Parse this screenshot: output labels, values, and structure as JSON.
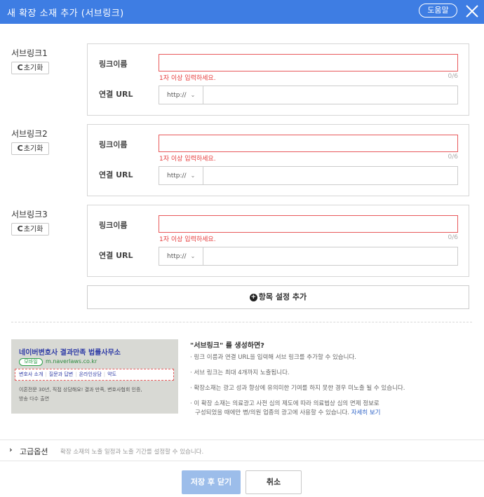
{
  "header": {
    "title": "새 확장 소재 추가 (서브링크)",
    "help_label": "도움말"
  },
  "reset_label": "초기화",
  "reset_icon_glyph": "C",
  "sublinks": [
    {
      "label": "서브링크1",
      "name_label": "링크이름",
      "error": "1자 이상 입력하세요.",
      "count": "0/6",
      "url_label": "연결 URL",
      "protocol": "http://"
    },
    {
      "label": "서브링크2",
      "name_label": "링크이름",
      "error": "1자 이상 입력하세요.",
      "count": "0/6",
      "url_label": "연결 URL",
      "protocol": "http://"
    },
    {
      "label": "서브링크3",
      "name_label": "링크이름",
      "error": "1자 이상 입력하세요.",
      "count": "0/6",
      "url_label": "연결 URL",
      "protocol": "http://"
    }
  ],
  "add_item_label": "항목 설정 추가",
  "preview": {
    "title": "네이버변호사 결과만족 법률사무소",
    "mobile_badge": "모바일",
    "url": "m.naverlaws.co.kr",
    "links": [
      "변호사 소개",
      "질문과 답변",
      "온라인상담",
      "약도"
    ],
    "desc_line1": "이혼전문 30년, 직접 상담해요! 결과 만족, 변호사협회 인증,",
    "desc_line2": "방송 다수 출연"
  },
  "info": {
    "title": "\"서브링크\" 를 생성하면?",
    "bullet1": "· 링크 이름과 연결 URL을 입력해 서브 링크를 추가할 수 있습니다.",
    "bullet2": "· 서브 링크는 최대 4개까지 노출됩니다.",
    "bullet3": "· 확장소재는 광고 성과 향상에 유의미한 기여를 하지 못한 경우 미노출 될 수 있습니다.",
    "bullet4_line1": "· 이 확장 소재는 의료광고 사전 심의 제도에 따라 의료법상 심의 면제 정보로",
    "bullet4_line2": "구성되었을 때에만 병/의원 업종의 광고에 사용할 수 있습니다.",
    "more_link": "자세히 보기"
  },
  "advanced": {
    "label": "고급옵션",
    "description": "확장 소재의 노출 일정과 노출 기간를 설정할 수 있습니다."
  },
  "footer": {
    "save_label": "저장 후 닫기",
    "cancel_label": "취소"
  },
  "colors": {
    "header_bg": "#3e7de3",
    "error": "#e63c3c",
    "save_button_bg": "#9cbdea",
    "link": "#2e63c7"
  }
}
